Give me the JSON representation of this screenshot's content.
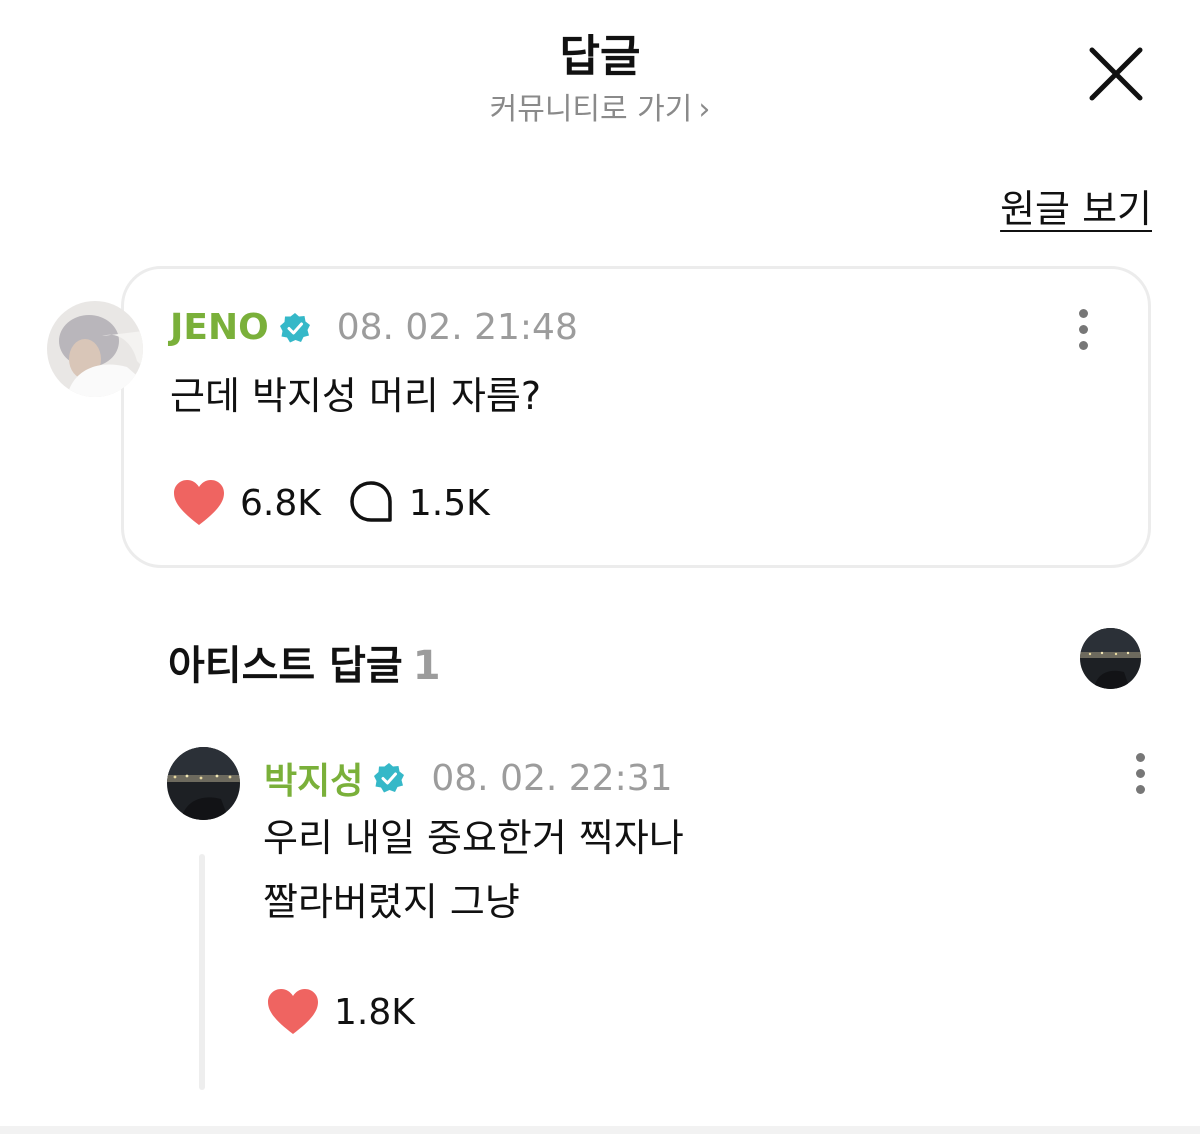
{
  "header": {
    "title": "답글",
    "subtitle": "커뮤니티로 가기",
    "subtitle_chevron": "›",
    "close_icon": "close-x-icon"
  },
  "view_original_label": "원글 보기",
  "post": {
    "author": "JENO",
    "timestamp": "08. 02. 21:48",
    "text": "근데 박지성 머리 자름?",
    "likes": "6.8K",
    "comments": "1.5K"
  },
  "artist_replies": {
    "title": "아티스트 답글",
    "count": "1"
  },
  "reply": {
    "author": "박지성",
    "timestamp": "08. 02. 22:31",
    "text_line1": "우리 내일 중요한거 찍자나",
    "text_line2": "짤라버렸지 그냥",
    "likes": "1.8K"
  },
  "colors": {
    "author_green": "#7ab03a",
    "verified_teal": "#35b8c8",
    "heart_red": "#ef6461",
    "muted_gray": "#9c9c9c"
  }
}
